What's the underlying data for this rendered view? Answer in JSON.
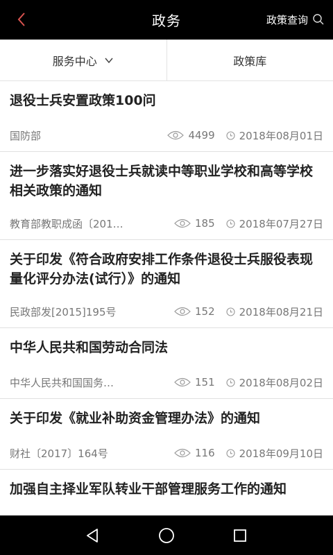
{
  "header": {
    "title": "政务",
    "query_label": "政策查询",
    "accent_color": "#d9534f"
  },
  "tabs": [
    {
      "label": "服务中心"
    },
    {
      "label": "政策库"
    }
  ],
  "items": [
    {
      "title": "退役士兵安置政策100问",
      "source": "国防部",
      "views": "4499",
      "date": "2018年08月01日"
    },
    {
      "title": "进一步落实好退役士兵就读中等职业学校和高等学校相关政策的通知",
      "source": "教育部教职成函〔201…",
      "views": "185",
      "date": "2018年07月27日"
    },
    {
      "title": "关于印发《符合政府安排工作条件退役士兵服役表现量化评分办法(试行）》的通知",
      "source": "民政部发[2015]195号",
      "views": "152",
      "date": "2018年08月21日"
    },
    {
      "title": "中华人民共和国劳动合同法",
      "source": "中华人民共和国国务…",
      "views": "151",
      "date": "2018年08月02日"
    },
    {
      "title": "关于印发《就业补助资金管理办法》的通知",
      "source": "财社〔2017〕164号",
      "views": "116",
      "date": "2018年09月10日"
    },
    {
      "title": "加强自主择业军队转业干部管理服务工作的通知",
      "source": "",
      "views": "",
      "date": ""
    }
  ]
}
